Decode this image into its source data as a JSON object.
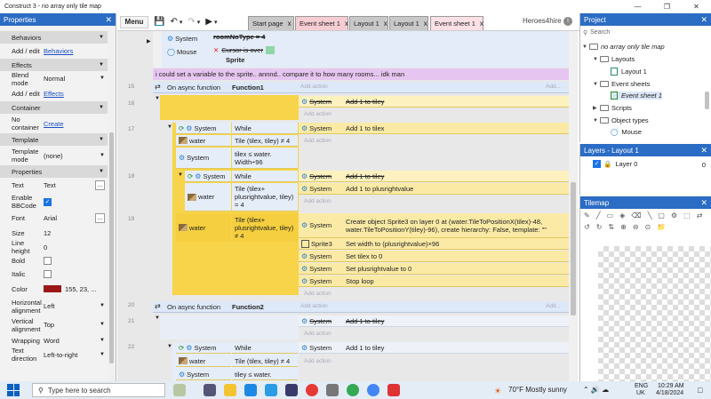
{
  "window": {
    "title": "Construct 3 - no array only tile map",
    "minimize": "—",
    "maximize": "❐",
    "close": "✕"
  },
  "properties": {
    "title": "Properties",
    "rows": [
      {
        "label": "Behaviors",
        "type": "section"
      },
      {
        "label": "Add / edit",
        "value": "Behaviors",
        "type": "link"
      },
      {
        "label": "Effects",
        "type": "section"
      },
      {
        "label": "Blend mode",
        "value": "Normal",
        "type": "select"
      },
      {
        "label": "Add / edit",
        "value": "Effects",
        "type": "link"
      },
      {
        "label": "Container",
        "type": "section"
      },
      {
        "label": "No container",
        "value": "Create",
        "type": "link"
      },
      {
        "label": "Template",
        "type": "section"
      },
      {
        "label": "Template mode",
        "value": "(none)",
        "type": "select"
      },
      {
        "label": "Properties",
        "type": "section"
      },
      {
        "label": "Text",
        "value": "Text",
        "type": "dots"
      },
      {
        "label": "Enable BBCode",
        "value": "",
        "type": "check-on"
      },
      {
        "label": "Font",
        "value": "Arial",
        "type": "dots"
      },
      {
        "label": "Size",
        "value": "12",
        "type": "plain"
      },
      {
        "label": "Line height",
        "value": "0",
        "type": "plain"
      },
      {
        "label": "Bold",
        "value": "",
        "type": "check"
      },
      {
        "label": "Italic",
        "value": "",
        "type": "check"
      },
      {
        "label": "Color",
        "value": "155, 23, ...",
        "type": "color"
      },
      {
        "label": "Horizontal alignment",
        "value": "Left",
        "type": "select"
      },
      {
        "label": "Vertical alignment",
        "value": "Top",
        "type": "select"
      },
      {
        "label": "Wrapping",
        "value": "Word",
        "type": "select"
      },
      {
        "label": "Text direction",
        "value": "Left-to-right",
        "type": "select"
      }
    ],
    "color_swatch": "#9b1717"
  },
  "toolbar": {
    "menu": "Menu",
    "hero": "Heroes4hire",
    "hero_badge": "i"
  },
  "tabs": [
    {
      "label": "Start page",
      "close": "x"
    },
    {
      "label": "Event sheet 1",
      "close": "x"
    },
    {
      "label": "Layout 1",
      "close": "x"
    },
    {
      "label": "Layout 1",
      "close": "x"
    },
    {
      "label": "Event sheet 1",
      "close": "x"
    }
  ],
  "sheet": {
    "top": {
      "sys_obj": "System",
      "sys_text": "roomNoType = 4",
      "mouse_obj": "Mouse",
      "mouse_text": "Cursor is over",
      "sprite_text": "Sprite"
    },
    "comment": "i could set a variable to the sprite.. annnd.. compare it to how many rooms... idk man",
    "add_action": "Add action",
    "add": "Add...",
    "lines": [
      "15",
      "16",
      "17",
      "18",
      "19",
      "20",
      "21",
      "22"
    ],
    "f1": {
      "header": "On async function",
      "name": "Function1"
    },
    "f2": {
      "header": "On async function",
      "name": "Function2"
    },
    "system": "System",
    "while": "While",
    "water": "water",
    "sprite3": "Sprite3",
    "c_tile_neq": "Tile (tilex, tiley) ≠ 4",
    "c_tilex_le": "tilex ≤ water. Width÷96",
    "c_tile_plus_y": "Tile (tilex+ plusrightvalue, tiley) = 4",
    "c_tile_plus_n": "Tile (tilex+ plusrightvalue, tiley) ≠ 4",
    "a_add1_tiley": "Add 1 to tiley",
    "a_add1_tilex": "Add 1 to tilex",
    "a_add1_plus": "Add 1 to plusrightvalue",
    "a_create": "Create object  Sprite3 on layer 0 at (water.TileToPositionX(tilex)-48, water.TileToPositionY(tiley)-96), create hierarchy: False, template: \"\"",
    "a_width": "Set width to (plusrightvalue)×96",
    "a_tilex0": "Set tilex to 0",
    "a_plus0": "Set plusrightvalue to 0",
    "a_stop": "Stop loop",
    "c_tile_neq2": "Tile (tilex, tiley) ≠ 4",
    "c_tiley_le": "tiley ≤ water.",
    "a_add1_tiley2": "Add 1 to tiley",
    "system_clipped": "System"
  },
  "project": {
    "title": "Project",
    "search": "Search",
    "items": [
      "no array only tile map",
      "Layouts",
      "Layout 1",
      "Event sheets",
      "Event sheet 1",
      "Scripts",
      "Object types",
      "Mouse"
    ]
  },
  "layers": {
    "title": "Layers - Layout 1",
    "item": "Layer 0",
    "count": "0"
  },
  "tilemap": {
    "title": "Tilemap"
  },
  "taskbar": {
    "search": "Type here to search",
    "weather": "70°F  Mostly sunny",
    "lang1": "ENG",
    "lang2": "UK",
    "time": "10:29 AM",
    "date": "4/18/2024"
  }
}
